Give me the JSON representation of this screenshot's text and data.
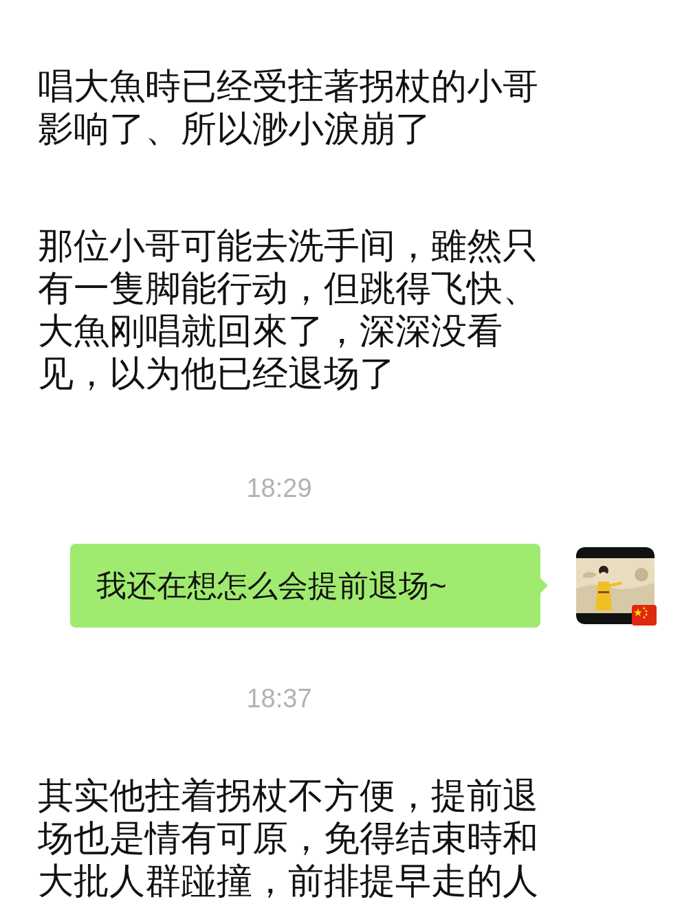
{
  "messages": [
    {
      "kind": "received",
      "text": "唱大魚時已经受拄著拐杖的小哥影响了、所以渺小淚崩了"
    },
    {
      "kind": "received",
      "text": "那位小哥可能去洗手间，雖然只有一隻脚能行动，但跳得飞快、大魚刚唱就回來了，深深没看见，以为他已经退场了"
    },
    {
      "kind": "time",
      "text": "18:29"
    },
    {
      "kind": "sent",
      "text": "我还在想怎么会提前退场~"
    },
    {
      "kind": "time",
      "text": "18:37"
    },
    {
      "kind": "received",
      "text": "其实他拄着拐杖不方便，提前退场也是情有可原，免得结束時和大批人群踫撞，前排提早走的人"
    }
  ]
}
